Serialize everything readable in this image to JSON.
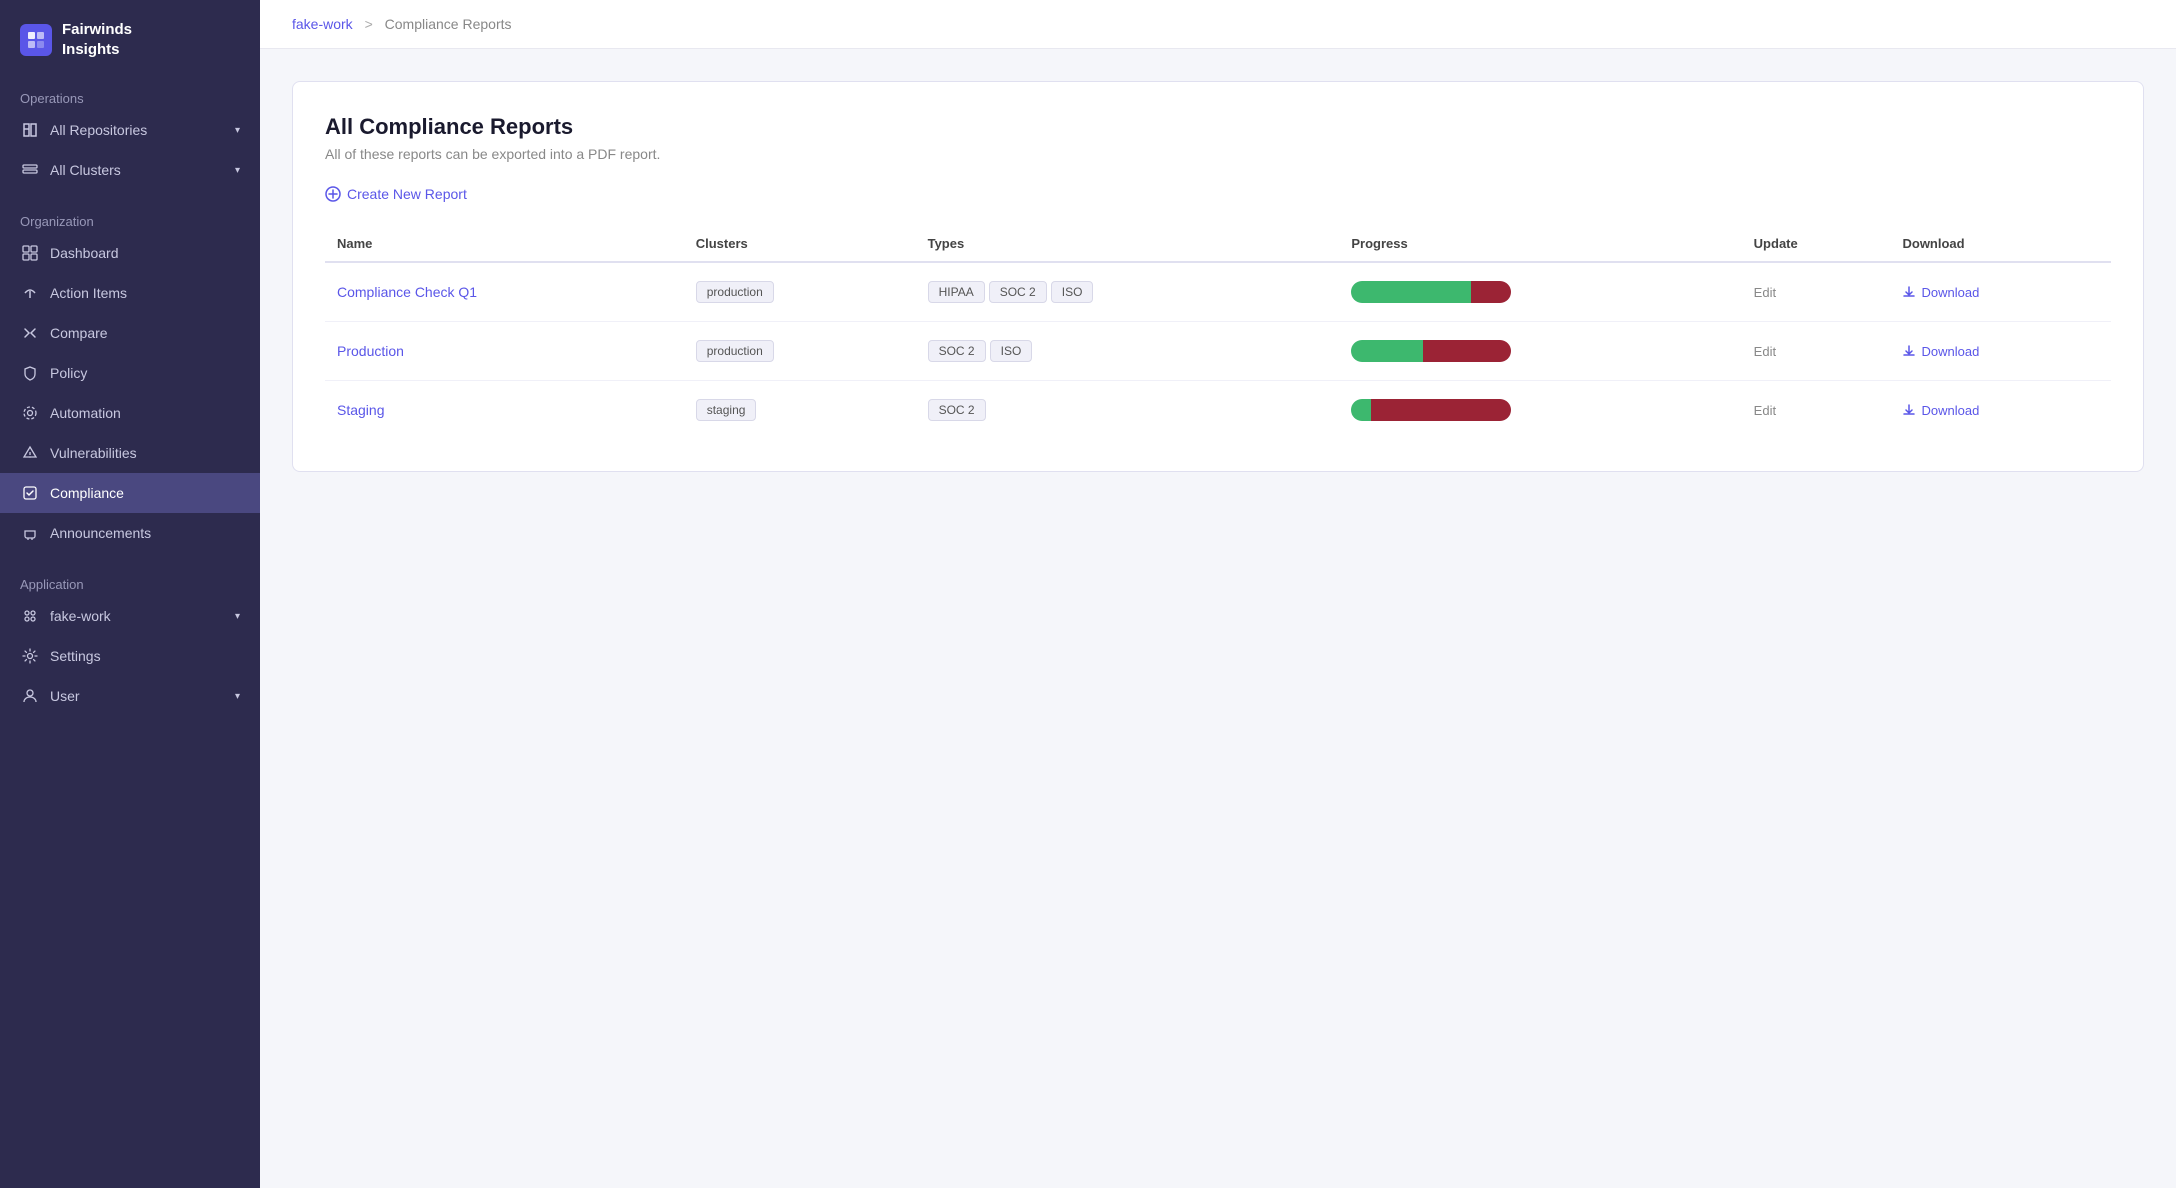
{
  "app": {
    "name": "Fairwinds",
    "name2": "Insights"
  },
  "breadcrumb": {
    "workspace": "fake-work",
    "separator": ">",
    "current": "Compliance Reports"
  },
  "sidebar": {
    "sections": [
      {
        "label": "Operations",
        "items": [
          {
            "id": "all-repositories",
            "label": "All Repositories",
            "hasChevron": true,
            "icon": "repos-icon"
          },
          {
            "id": "all-clusters",
            "label": "All Clusters",
            "hasChevron": true,
            "icon": "clusters-icon"
          }
        ]
      },
      {
        "label": "Organization",
        "items": [
          {
            "id": "dashboard",
            "label": "Dashboard",
            "icon": "dashboard-icon"
          },
          {
            "id": "action-items",
            "label": "Action Items",
            "icon": "action-items-icon"
          },
          {
            "id": "compare",
            "label": "Compare",
            "icon": "compare-icon"
          },
          {
            "id": "policy",
            "label": "Policy",
            "icon": "policy-icon"
          },
          {
            "id": "automation",
            "label": "Automation",
            "icon": "automation-icon"
          },
          {
            "id": "vulnerabilities",
            "label": "Vulnerabilities",
            "icon": "vuln-icon"
          },
          {
            "id": "compliance",
            "label": "Compliance",
            "icon": "compliance-icon",
            "active": true
          },
          {
            "id": "announcements",
            "label": "Announcements",
            "icon": "announce-icon"
          }
        ]
      },
      {
        "label": "Application",
        "items": [
          {
            "id": "fake-work",
            "label": "fake-work",
            "hasChevron": true,
            "icon": "app-icon"
          },
          {
            "id": "settings",
            "label": "Settings",
            "icon": "settings-icon"
          },
          {
            "id": "user",
            "label": "User",
            "hasChevron": true,
            "icon": "user-icon"
          }
        ]
      }
    ]
  },
  "page": {
    "title": "All Compliance Reports",
    "subtitle": "All of these reports can be exported into a PDF report.",
    "create_btn": "Create New Report"
  },
  "table": {
    "columns": [
      "Name",
      "Clusters",
      "Types",
      "Progress",
      "Update",
      "Download"
    ],
    "rows": [
      {
        "name": "Compliance Check Q1",
        "cluster": "production",
        "types": [
          "HIPAA",
          "SOC 2",
          "ISO"
        ],
        "progress_green": 75,
        "progress_red": 25,
        "update": "Edit",
        "download": "Download"
      },
      {
        "name": "Production",
        "cluster": "production",
        "types": [
          "SOC 2",
          "ISO"
        ],
        "progress_green": 45,
        "progress_red": 55,
        "update": "Edit",
        "download": "Download"
      },
      {
        "name": "Staging",
        "cluster": "staging",
        "types": [
          "SOC 2"
        ],
        "progress_green": 12,
        "progress_red": 88,
        "update": "Edit",
        "download": "Download"
      }
    ]
  }
}
